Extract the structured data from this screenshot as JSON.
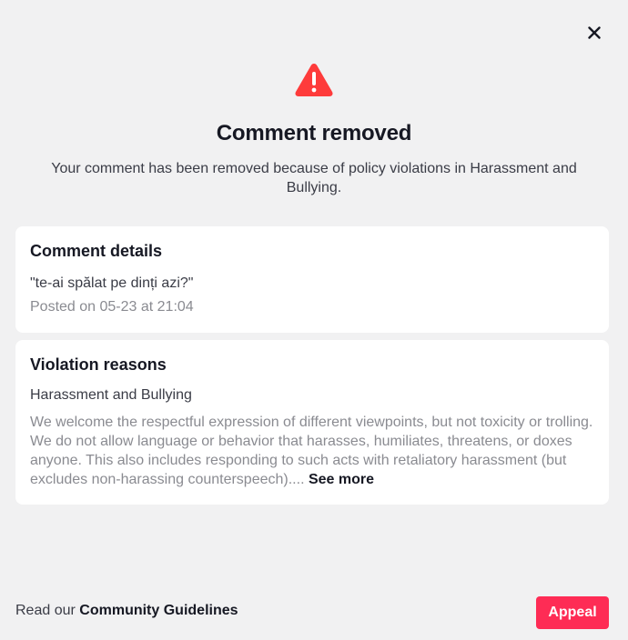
{
  "dialog": {
    "title": "Comment removed",
    "subtitle": "Your comment has been removed because of policy violations in Harassment and Bullying.",
    "warning_icon": "warning-triangle-icon",
    "close_icon": "close-icon",
    "accent_color": "#fe2c55",
    "warning_color": "#fe3b3b"
  },
  "comment_details": {
    "heading": "Comment details",
    "quote": "\"te-ai spălat pe dinți azi?\"",
    "posted": "Posted on 05-23 at 21:04"
  },
  "violation": {
    "heading": "Violation reasons",
    "reason": "Harassment and Bullying",
    "description": "We welcome the respectful expression of different viewpoints, but not toxicity or trolling. We do not allow language or behavior that harasses, humiliates, threatens, or doxes anyone. This also includes responding to such acts with retaliatory harassment (but excludes non-harassing counterspeech).",
    "ellipsis": "...",
    "see_more": "See more"
  },
  "footer": {
    "prefix": "Read our",
    "link": "Community Guidelines",
    "appeal": "Appeal"
  }
}
